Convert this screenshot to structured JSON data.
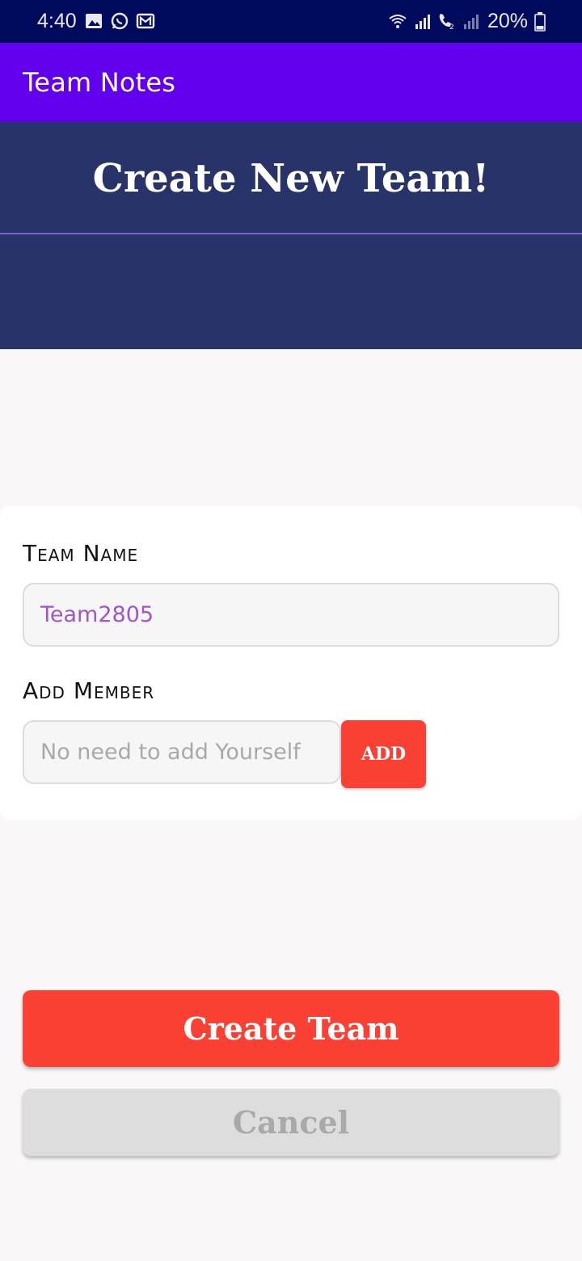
{
  "status_bar": {
    "time": "4:40",
    "left_icons": [
      "gallery-icon",
      "whatsapp-icon",
      "mail-icon"
    ],
    "right_icons": [
      "wifi-icon",
      "signal-icon",
      "volte-call-icon",
      "signal-icon"
    ],
    "battery_text": "20%"
  },
  "app_bar": {
    "title": "Team Notes"
  },
  "hero": {
    "heading": "Create New Team!"
  },
  "form": {
    "team_name_label": "Team Name",
    "team_name_value": "Team2805",
    "add_member_label": "Add Member",
    "add_member_placeholder": "No need to add Yourself",
    "add_button_label": "ADD"
  },
  "actions": {
    "create_label": "Create Team",
    "cancel_label": "Cancel"
  },
  "colors": {
    "status_bar": "#000a5c",
    "app_bar": "#6200ee",
    "hero": "#283469",
    "accent_red": "#fb4133",
    "cancel_bg": "#dddddd"
  }
}
